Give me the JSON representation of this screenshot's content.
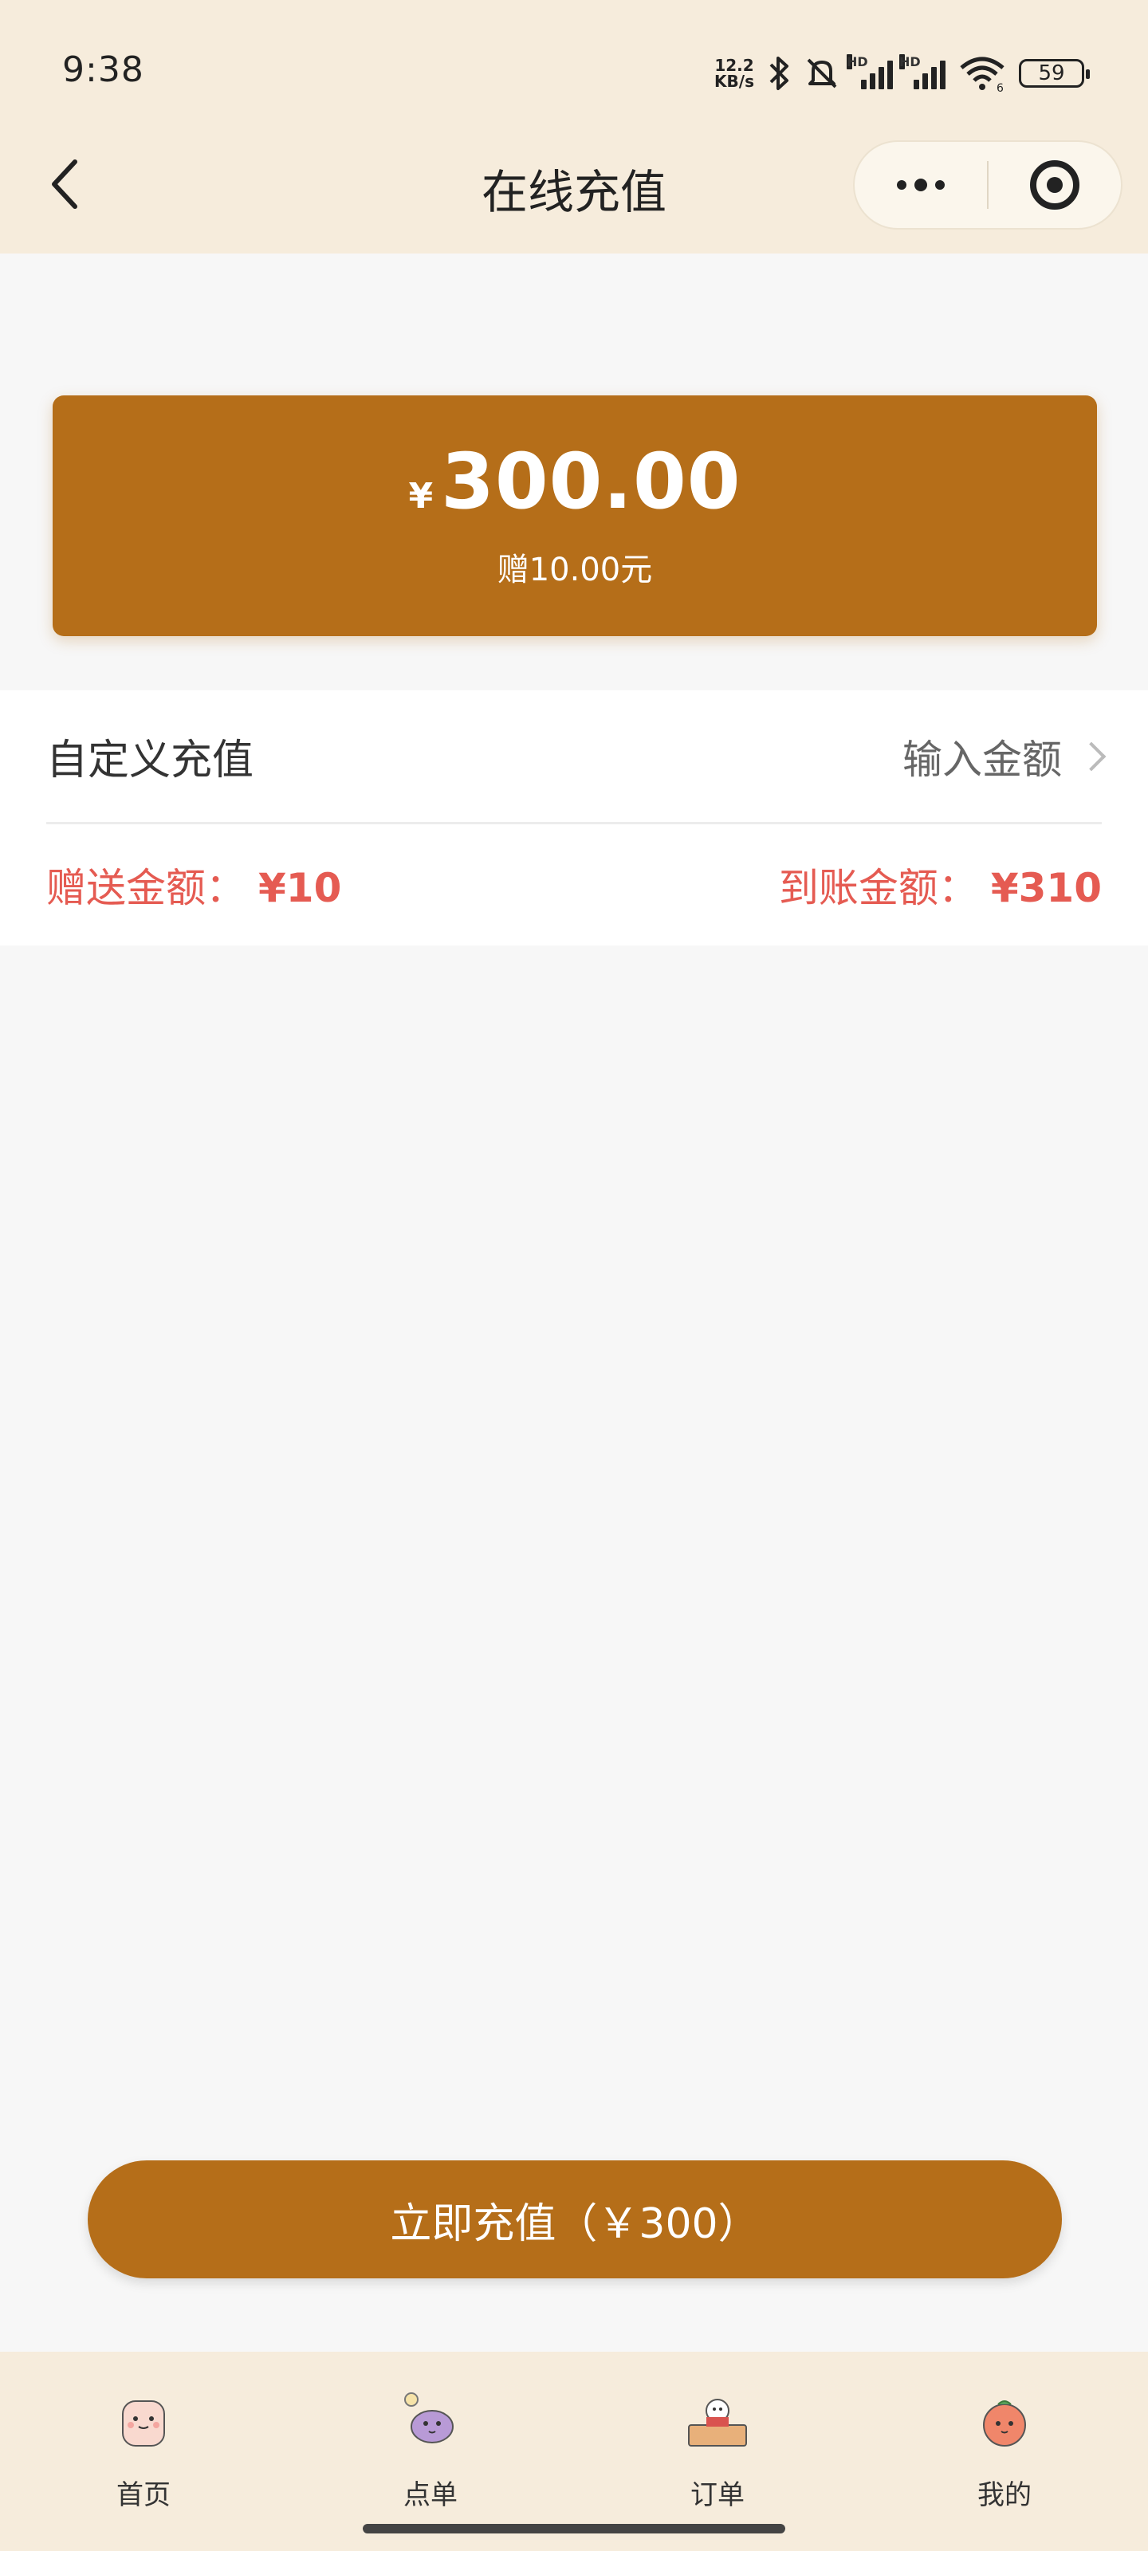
{
  "status_bar": {
    "time": "9:38",
    "net_speed_value": "12.2",
    "net_speed_unit": "KB/s",
    "hd_label": "HD",
    "wifi_sub": "6",
    "battery": "59",
    "icons": [
      "bluetooth-icon",
      "mute-bell-icon",
      "signal-icon",
      "signal-icon",
      "wifi-icon",
      "battery-icon"
    ]
  },
  "header": {
    "title": "在线充值",
    "back_icon": "chevron-left-icon",
    "capsule_icons": [
      "more-dots-icon",
      "target-icon"
    ]
  },
  "selected_option": {
    "currency": "¥",
    "amount": "300.00",
    "bonus": "赠10.00元"
  },
  "custom": {
    "label": "自定义充值",
    "input_placeholder": "输入金额"
  },
  "summary": {
    "gift_label": "赠送金额：",
    "gift_value": "¥10",
    "arrive_label": "到账金额：",
    "arrive_value": "¥310"
  },
  "pay_button": {
    "label": "立即充值（￥300）"
  },
  "tabbar": {
    "tabs": [
      {
        "label": "首页",
        "icon": "home-mascot-icon"
      },
      {
        "label": "点单",
        "icon": "order-mascot-icon"
      },
      {
        "label": "订单",
        "icon": "orders-mascot-icon"
      },
      {
        "label": "我的",
        "icon": "profile-mascot-icon"
      }
    ]
  },
  "colors": {
    "accent": "#b56e19",
    "header_bg": "#f6ecdc",
    "highlight_red": "#e55b52"
  }
}
